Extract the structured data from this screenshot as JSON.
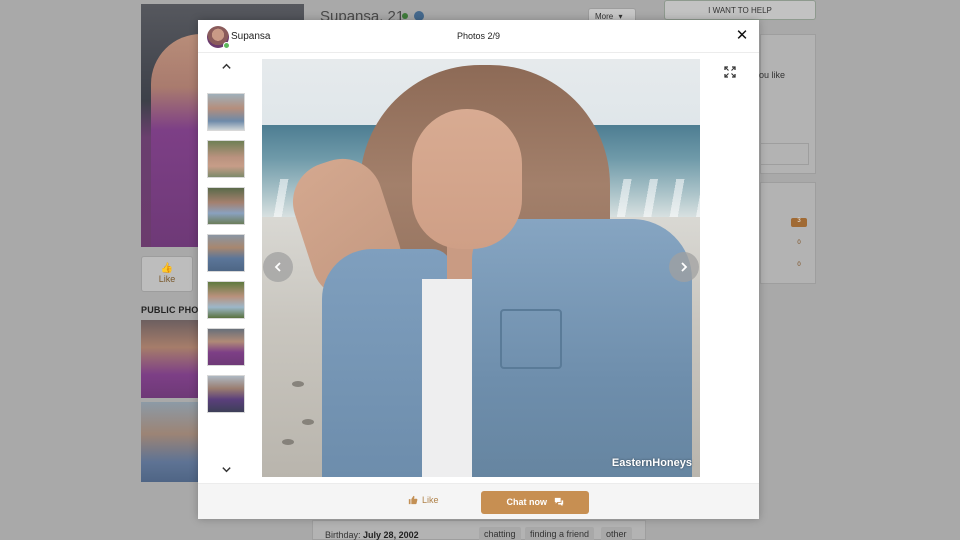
{
  "background": {
    "profile_title": "Supansa, 21",
    "more_button": "More",
    "more_chevron": "▾",
    "help_button": "I WANT TO HELP",
    "side_text": "ou like",
    "like_label": "Like",
    "public_photos_label": "PUBLIC PHOT",
    "badges": [
      "3",
      "0",
      "0"
    ],
    "birthday_label": "Birthday:",
    "birthday_value": "July 28, 2002",
    "interest_tags": [
      "chatting",
      "finding a friend",
      "other"
    ]
  },
  "modal": {
    "user_name": "Supansa",
    "photo_counter": "Photos 2/9",
    "close_glyph": "✕",
    "watermark": "EasternHoneys",
    "like_label": "Like",
    "chat_label": "Chat now"
  },
  "colors": {
    "accent": "#c78f52",
    "like_text": "#b0834b",
    "online": "#5cb85c"
  },
  "icons": [
    "close-icon",
    "chevron-up-icon",
    "chevron-down-icon",
    "chevron-left-icon",
    "chevron-right-icon",
    "expand-icon",
    "thumbs-up-icon",
    "chat-bubbles-icon",
    "verified-icon"
  ]
}
